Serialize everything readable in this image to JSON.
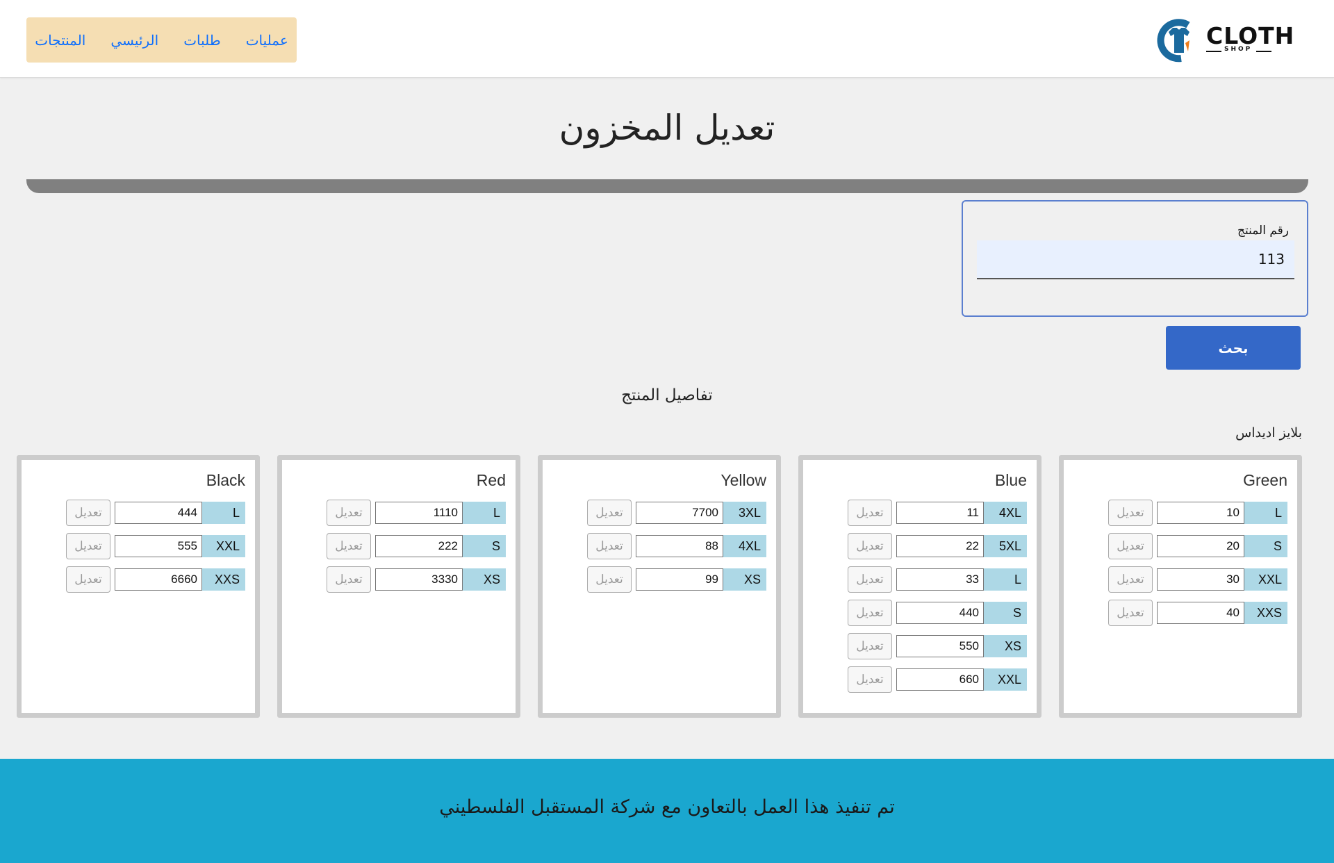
{
  "header": {
    "nav": [
      "عمليات",
      "طلبات",
      "الرئيسي",
      "المنتجات"
    ],
    "logo": {
      "brand": "CLOTH",
      "sub": "SHOP"
    }
  },
  "page": {
    "title": "تعديل المخزون"
  },
  "search": {
    "label": "رقم المنتج",
    "value": "113",
    "button_label": "بحث"
  },
  "details": {
    "title": "تفاصيل المنتج",
    "product_name": "بلايز اديداس"
  },
  "edit_label": "تعديل",
  "colors": [
    {
      "name": "Green",
      "rows": [
        {
          "size": "L",
          "qty": "10"
        },
        {
          "size": "S",
          "qty": "20"
        },
        {
          "size": "XXL",
          "qty": "30"
        },
        {
          "size": "XXS",
          "qty": "40"
        }
      ]
    },
    {
      "name": "Blue",
      "rows": [
        {
          "size": "4XL",
          "qty": "11"
        },
        {
          "size": "5XL",
          "qty": "22"
        },
        {
          "size": "L",
          "qty": "33"
        },
        {
          "size": "S",
          "qty": "440"
        },
        {
          "size": "XS",
          "qty": "550"
        },
        {
          "size": "XXL",
          "qty": "660"
        }
      ]
    },
    {
      "name": "Yellow",
      "rows": [
        {
          "size": "3XL",
          "qty": "7700"
        },
        {
          "size": "4XL",
          "qty": "88"
        },
        {
          "size": "XS",
          "qty": "99"
        }
      ]
    },
    {
      "name": "Red",
      "rows": [
        {
          "size": "L",
          "qty": "1110"
        },
        {
          "size": "S",
          "qty": "222"
        },
        {
          "size": "XS",
          "qty": "3330"
        }
      ]
    },
    {
      "name": "Black",
      "rows": [
        {
          "size": "L",
          "qty": "444"
        },
        {
          "size": "XXL",
          "qty": "555"
        },
        {
          "size": "XXS",
          "qty": "6660"
        }
      ]
    }
  ],
  "footer": {
    "text": "تم تنفيذ هذا العمل بالتعاون مع شركة المستقبل الفلسطيني"
  },
  "theme": {
    "nav_bg": "#f5deb3",
    "link": "#0d6efd",
    "primary_button": "#3468c8",
    "size_label_bg": "#add8e6",
    "footer_bg": "#1aa7cf"
  }
}
